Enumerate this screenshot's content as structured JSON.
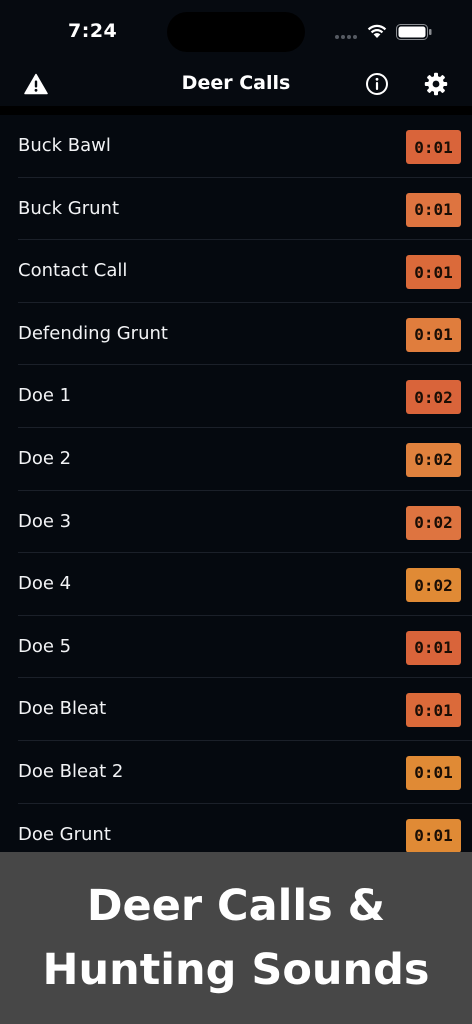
{
  "status_bar": {
    "time": "7:24"
  },
  "nav": {
    "title": "Deer Calls",
    "left_icon": "warning-icon",
    "right_icons": [
      "info-icon",
      "gear-icon"
    ]
  },
  "calls": [
    {
      "name": "Buck Bawl",
      "duration": "0:01",
      "color": "#d9643a"
    },
    {
      "name": "Buck Grunt",
      "duration": "0:01",
      "color": "#de7440"
    },
    {
      "name": "Contact Call",
      "duration": "0:01",
      "color": "#db6a3a"
    },
    {
      "name": "Defending Grunt",
      "duration": "0:01",
      "color": "#e07d3d"
    },
    {
      "name": "Doe 1",
      "duration": "0:02",
      "color": "#d9643a"
    },
    {
      "name": "Doe 2",
      "duration": "0:02",
      "color": "#e0813d"
    },
    {
      "name": "Doe 3",
      "duration": "0:02",
      "color": "#de7440"
    },
    {
      "name": "Doe 4",
      "duration": "0:02",
      "color": "#e08a35"
    },
    {
      "name": "Doe 5",
      "duration": "0:01",
      "color": "#d9643a"
    },
    {
      "name": "Doe Bleat",
      "duration": "0:01",
      "color": "#db6a3a"
    },
    {
      "name": "Doe Bleat 2",
      "duration": "0:01",
      "color": "#e08a35"
    },
    {
      "name": "Doe Grunt",
      "duration": "0:01",
      "color": "#e08a35"
    }
  ],
  "promo": {
    "line1": "Deer Calls &",
    "line2": "Hunting Sounds"
  }
}
